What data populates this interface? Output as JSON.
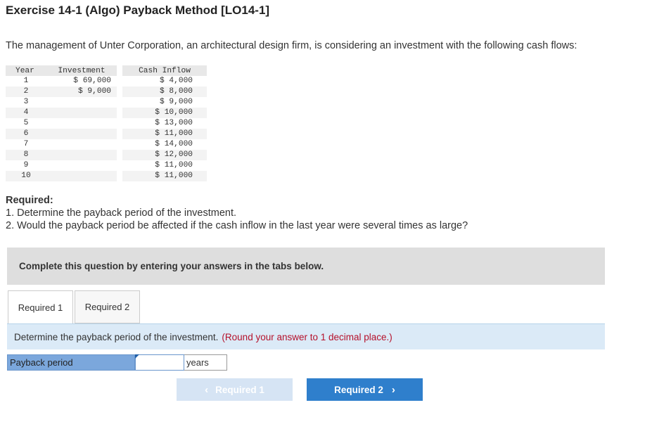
{
  "title": "Exercise 14-1 (Algo) Payback Method [LO14-1]",
  "intro": "The management of Unter Corporation, an architectural design firm, is considering an investment with the following cash flows:",
  "table": {
    "headers": {
      "year": "Year",
      "investment": "Investment",
      "cash_inflow": "Cash Inflow"
    },
    "rows": [
      {
        "year": "1",
        "investment": "$ 69,000",
        "cash_inflow": "$ 4,000"
      },
      {
        "year": "2",
        "investment": "$ 9,000",
        "cash_inflow": "$ 8,000"
      },
      {
        "year": "3",
        "investment": "",
        "cash_inflow": "$ 9,000"
      },
      {
        "year": "4",
        "investment": "",
        "cash_inflow": "$ 10,000"
      },
      {
        "year": "5",
        "investment": "",
        "cash_inflow": "$ 13,000"
      },
      {
        "year": "6",
        "investment": "",
        "cash_inflow": "$ 11,000"
      },
      {
        "year": "7",
        "investment": "",
        "cash_inflow": "$ 14,000"
      },
      {
        "year": "8",
        "investment": "",
        "cash_inflow": "$ 12,000"
      },
      {
        "year": "9",
        "investment": "",
        "cash_inflow": "$ 11,000"
      },
      {
        "year": "10",
        "investment": "",
        "cash_inflow": "$ 11,000"
      }
    ]
  },
  "required": {
    "heading": "Required:",
    "items": [
      "1. Determine the payback period of the investment.",
      "2. Would the payback period be affected if the cash inflow in the last year were several times as large?"
    ]
  },
  "banner": "Complete this question by entering your answers in the tabs below.",
  "tabs": [
    {
      "label": "Required 1",
      "active": true
    },
    {
      "label": "Required 2",
      "active": false
    }
  ],
  "instruction": {
    "question": "Determine the payback period of the investment.",
    "hint": "(Round your answer to 1 decimal place.)"
  },
  "answer": {
    "label": "Payback period",
    "value": "",
    "unit": "years"
  },
  "nav": {
    "prev_label": "Required 1",
    "next_label": "Required 2",
    "prev_icon": "chevron-left-icon",
    "next_icon": "chevron-right-icon"
  },
  "colors": {
    "banner_bg": "#dedede",
    "instruction_bg": "#dbeaf7",
    "hint_red": "#b5112b",
    "label_blue": "#7ba7dc",
    "next_button": "#2f7fcc",
    "prev_button_disabled": "#d6e4f4"
  }
}
